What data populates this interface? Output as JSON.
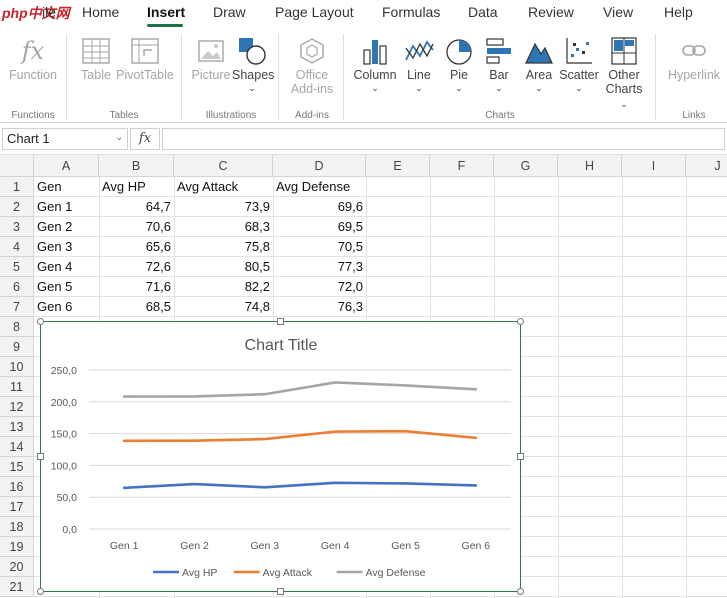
{
  "ribbon": {
    "tabs": [
      "ile",
      "Home",
      "Insert",
      "Draw",
      "Page Layout",
      "Formulas",
      "Data",
      "Review",
      "View",
      "Help"
    ],
    "active_tab": "Insert",
    "watermark": "php中文网",
    "buttons": {
      "function": "Function",
      "table": "Table",
      "pivottable": "PivotTable",
      "picture": "Picture",
      "shapes": "Shapes",
      "office_addins_1": "Office",
      "office_addins_2": "Add-ins",
      "column": "Column",
      "line": "Line",
      "pie": "Pie",
      "bar": "Bar",
      "area": "Area",
      "scatter": "Scatter",
      "other_1": "Other",
      "other_2": "Charts",
      "hyperlink": "Hyperlink"
    },
    "groups": {
      "functions": "Functions",
      "tables": "Tables",
      "illustrations": "Illustrations",
      "addins": "Add-ins",
      "charts": "Charts",
      "links": "Links"
    }
  },
  "formula_bar": {
    "name_box": "Chart 1",
    "fx_label": "fx",
    "formula": ""
  },
  "sheet": {
    "columns": [
      "A",
      "B",
      "C",
      "D",
      "E",
      "F",
      "G",
      "H",
      "I",
      "J"
    ],
    "rows": [
      "1",
      "2",
      "3",
      "4",
      "5",
      "6",
      "7",
      "8",
      "9",
      "10",
      "11",
      "12",
      "13",
      "14",
      "15",
      "16",
      "17",
      "18",
      "19",
      "20",
      "21"
    ],
    "headers": [
      "Gen",
      "Avg HP",
      "Avg Attack",
      "Avg Defense"
    ],
    "data": [
      [
        "Gen 1",
        "64,7",
        "73,9",
        "69,6"
      ],
      [
        "Gen 2",
        "70,6",
        "68,3",
        "69,5"
      ],
      [
        "Gen 3",
        "65,6",
        "75,8",
        "70,5"
      ],
      [
        "Gen 4",
        "72,6",
        "80,5",
        "77,3"
      ],
      [
        "Gen 5",
        "71,6",
        "82,2",
        "72,0"
      ],
      [
        "Gen 6",
        "68,5",
        "74,8",
        "76,3"
      ]
    ]
  },
  "chart_data": {
    "type": "line",
    "stacked": true,
    "title": "Chart Title",
    "categories": [
      "Gen 1",
      "Gen 2",
      "Gen 3",
      "Gen 4",
      "Gen 5",
      "Gen 6"
    ],
    "series": [
      {
        "name": "Avg HP",
        "color": "#4472c4",
        "values": [
          64.7,
          70.6,
          65.6,
          72.6,
          71.6,
          68.5
        ]
      },
      {
        "name": "Avg Attack",
        "color": "#ed7d31",
        "values": [
          73.9,
          68.3,
          75.8,
          80.5,
          82.2,
          74.8
        ]
      },
      {
        "name": "Avg Defense",
        "color": "#a5a5a5",
        "values": [
          69.6,
          69.5,
          70.5,
          77.3,
          72.0,
          76.3
        ]
      }
    ],
    "ylim": [
      0,
      250
    ],
    "yticks": [
      "0,0",
      "50,0",
      "100,0",
      "150,0",
      "200,0",
      "250,0"
    ],
    "grid": true,
    "legend": "bottom"
  }
}
